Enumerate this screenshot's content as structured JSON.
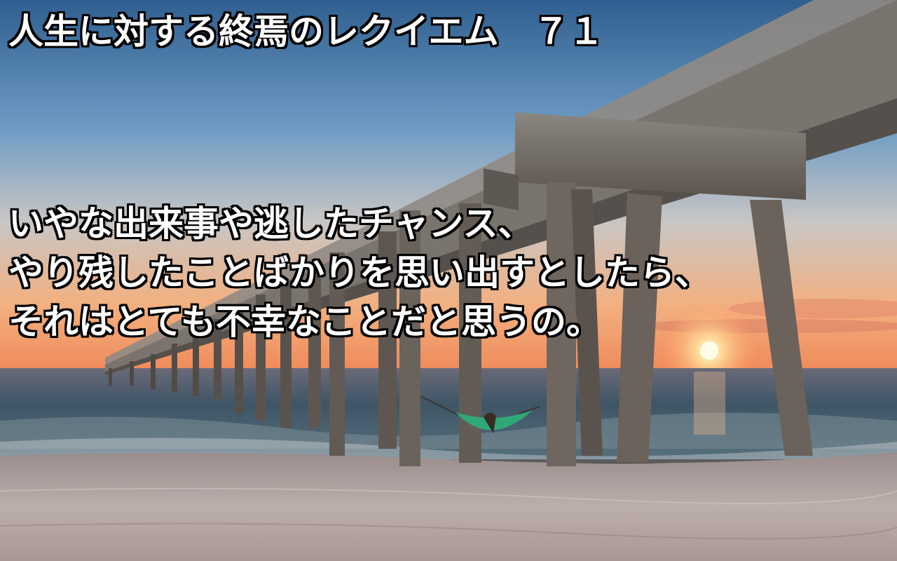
{
  "title": "人生に対する終焉のレクイエム　７１",
  "body_lines": [
    "いやな出来事や逃したチャンス、",
    "やり残したことばかりを思い出すとしたら、",
    "それはとても不幸なことだと思うの。"
  ],
  "colors": {
    "text": "#ffffff",
    "text_outline": "#000000",
    "sky_top": "#3f6f9f",
    "sky_horizon": "#f0a070",
    "sun": "#fff6d0",
    "sea": "#3d5566",
    "sand": "#b9a9a4",
    "pier": "#6a625c",
    "hammock": "#2fa878"
  },
  "scene_elements": [
    "sky",
    "sun",
    "sea",
    "pier",
    "hammock",
    "beach-sand"
  ]
}
